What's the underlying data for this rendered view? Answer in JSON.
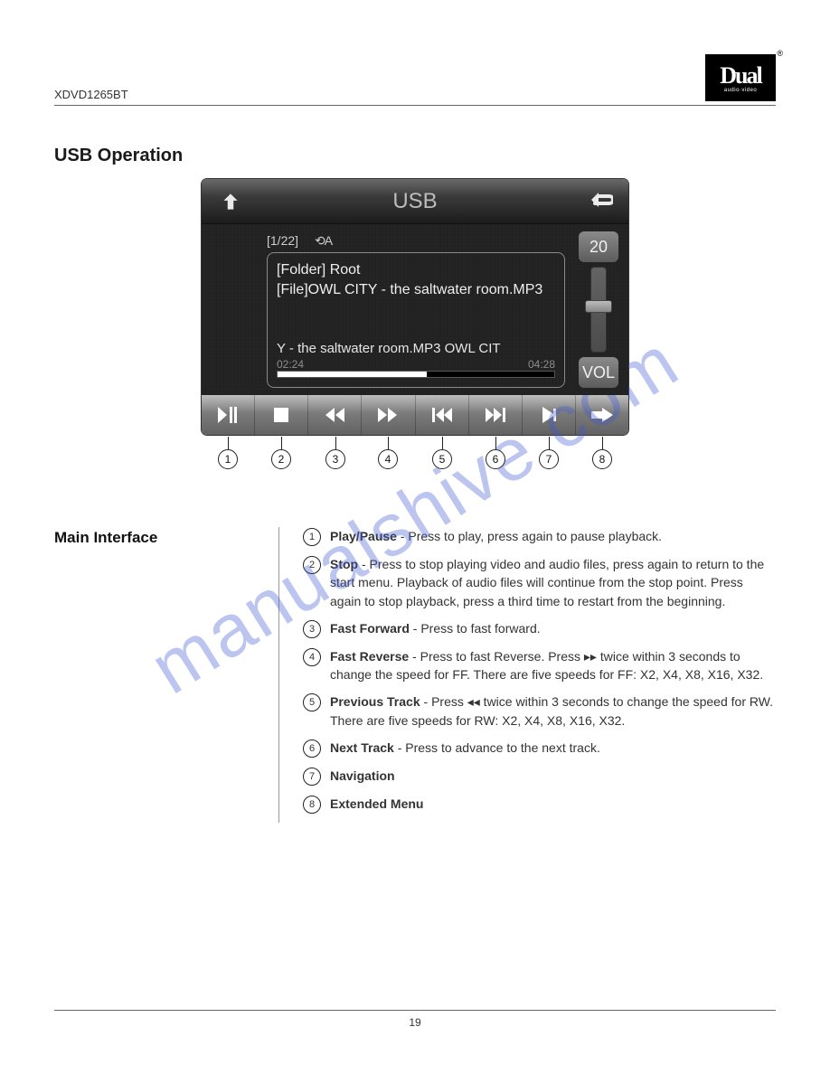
{
  "header": {
    "model": "XDVD1265BT",
    "logo_top": "Dual",
    "logo_sub": "audio·video"
  },
  "section_title": "USB Operation",
  "screen": {
    "title": "USB",
    "track_index": "[1/22]",
    "repeat_label": "⟲A",
    "folder_line": "[Folder] Root",
    "file_line": "[File]OWL CITY - the saltwater room.MP3",
    "scroll_line": "Y - the saltwater room.MP3  OWL CIT",
    "elapsed": "02:24",
    "total": "04:28",
    "volume_value": "20",
    "volume_label": "VOL"
  },
  "callouts": [
    "1",
    "2",
    "3",
    "4",
    "5",
    "6",
    "7",
    "8"
  ],
  "left_label": "Main Interface",
  "items": [
    {
      "n": "1",
      "title": "Play/Pause",
      "body": " - Press to play, press again to pause playback."
    },
    {
      "n": "2",
      "title": "Stop",
      "body": " - Press to stop playing video and audio files, press again to return to the start menu. Playback of audio files will continue from the stop point. Press again to stop playback, press a third time to restart from the beginning."
    },
    {
      "n": "3",
      "title": "Fast Forward",
      "body": " - Press to fast forward."
    },
    {
      "n": "4",
      "title": "Fast Reverse",
      "body": " - Press to fast Reverse. Press ▸▸ twice within 3 seconds to change the speed for FF. There are five speeds for FF: X2, X4, X8, X16, X32."
    },
    {
      "n": "5",
      "title": "Previous Track",
      "body": " - Press ◂◂ twice within 3 seconds to change the speed for RW. There are five speeds for RW: X2, X4, X8, X16, X32."
    },
    {
      "n": "6",
      "title": "Next Track",
      "body": " - Press to advance to the next track."
    },
    {
      "n": "7",
      "title": "Navigation",
      "body": ""
    },
    {
      "n": "8",
      "title": "Extended Menu",
      "body": ""
    }
  ],
  "footer": "19",
  "watermark": "manualshive.com"
}
